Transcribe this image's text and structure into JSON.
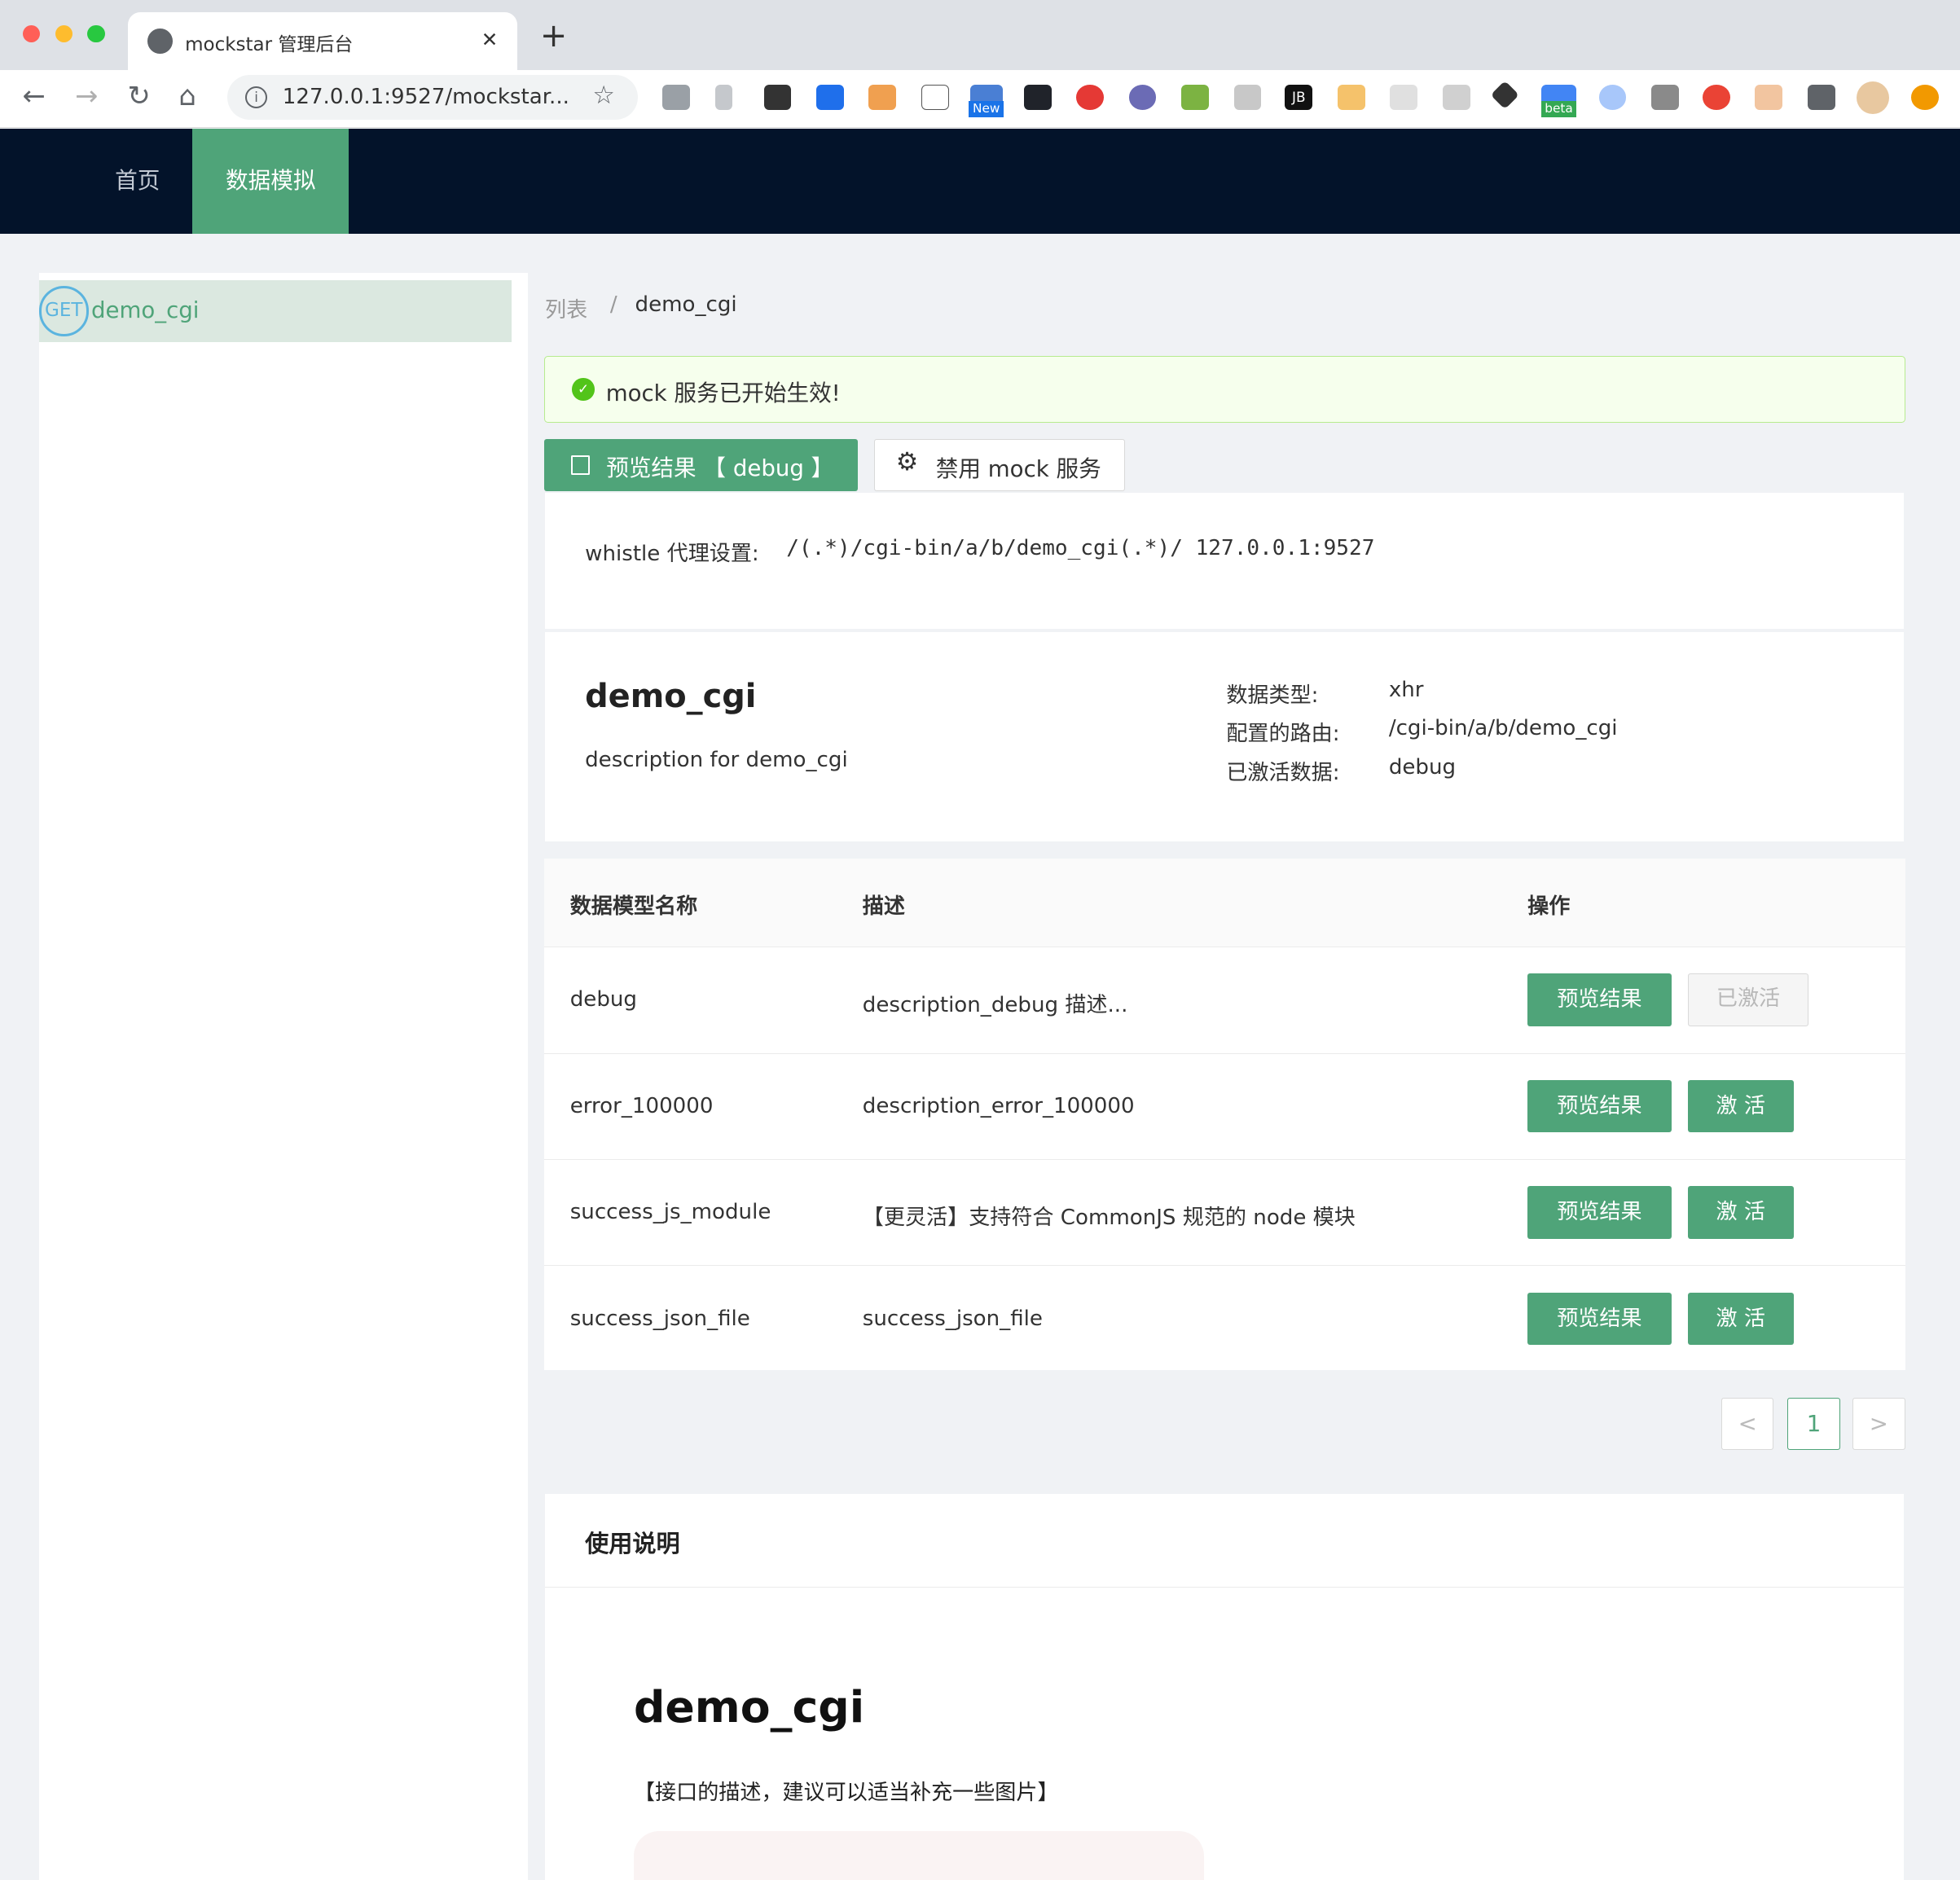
{
  "browser": {
    "tab_title": "mockstar 管理后台",
    "tab_close": "✕",
    "new_tab": "+",
    "url": "127.0.0.1:9527/mockstar...",
    "ext_new": "New",
    "ext_beta": "beta",
    "ext_jb": "JB"
  },
  "nav": {
    "home": "首页",
    "mock": "数据模拟"
  },
  "sidebar": {
    "items": [
      {
        "method": "GET",
        "name": "demo_cgi"
      }
    ]
  },
  "breadcrumb": {
    "root": "列表",
    "sep": "/",
    "current": "demo_cgi"
  },
  "alert": {
    "text": "mock 服务已开始生效!"
  },
  "actions": {
    "preview": "预览结果 【 debug 】",
    "disable": "禁用 mock 服务"
  },
  "proxy": {
    "label": "whistle 代理设置:",
    "rule": "/(.*)/cgi-bin/a/b/demo_cgi(.*)/ 127.0.0.1:9527"
  },
  "cgi": {
    "name": "demo_cgi",
    "description": "description for demo_cgi",
    "type_label": "数据类型:",
    "type_value": "xhr",
    "route_label": "配置的路由:",
    "route_value": "/cgi-bin/a/b/demo_cgi",
    "active_label": "已激活数据:",
    "active_value": "debug"
  },
  "table": {
    "headers": {
      "name": "数据模型名称",
      "desc": "描述",
      "ops": "操作"
    },
    "rows": [
      {
        "name": "debug",
        "desc": "description_debug 描述...",
        "preview": "预览结果",
        "state": "已激活"
      },
      {
        "name": "error_100000",
        "desc": "description_error_100000",
        "preview": "预览结果",
        "state": "激 活"
      },
      {
        "name": "success_js_module",
        "desc": "【更灵活】支持符合 CommonJS 规范的 node 模块",
        "preview": "预览结果",
        "state": "激 活"
      },
      {
        "name": "success_json_file",
        "desc": "success_json_file",
        "preview": "预览结果",
        "state": "激 活"
      }
    ]
  },
  "pagination": {
    "prev": "<",
    "page": "1",
    "next": ">"
  },
  "usage": {
    "title": "使用说明",
    "doc_title": "demo_cgi",
    "doc_desc": "【接口的描述，建议可以适当补充一些图片】"
  }
}
